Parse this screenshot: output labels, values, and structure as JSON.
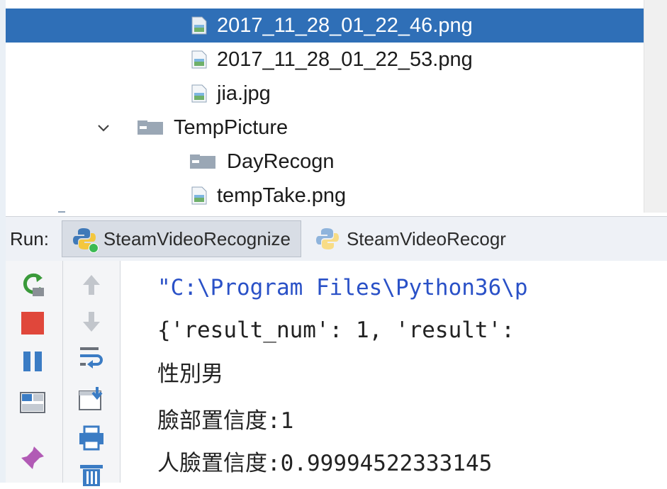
{
  "project_tree": {
    "items": [
      {
        "label": "2017_11_28_01_22_46.png",
        "type": "image-file",
        "selected": true
      },
      {
        "label": "2017_11_28_01_22_53.png",
        "type": "image-file",
        "selected": false
      },
      {
        "label": "jia.jpg",
        "type": "image-file",
        "selected": false
      },
      {
        "label": "TempPicture",
        "type": "folder",
        "expanded": true,
        "selected": false
      },
      {
        "label": "DayRecogn",
        "type": "folder",
        "selected": false
      },
      {
        "label": "tempTake.png",
        "type": "image-file",
        "selected": false
      }
    ]
  },
  "run_panel": {
    "label": "Run:",
    "tabs": [
      {
        "label": "SteamVideoRecognize",
        "active": true
      },
      {
        "label": "SteamVideoRecogr",
        "active": false
      }
    ]
  },
  "left_toolbar": [
    "rerun-icon",
    "stop-icon",
    "pause-icon",
    "restore-layout-icon",
    "pin-icon"
  ],
  "right_toolbar": [
    "up-arrow-icon",
    "down-arrow-icon",
    "soft-wrap-icon",
    "scroll-to-end-icon",
    "print-icon",
    "trash-icon"
  ],
  "console": {
    "lines": [
      "\"C:\\Program Files\\Python36\\p",
      "{'result_num': 1, 'result':",
      "性別男",
      "臉部置信度:1",
      "人臉置信度:0.99994522333145"
    ]
  },
  "colors": {
    "selection": "#2f6fb7",
    "command_text": "#2a51c7",
    "stop_red": "#e0473b",
    "rerun_green": "#3a9a3a",
    "pause_blue": "#3b7cc4"
  }
}
